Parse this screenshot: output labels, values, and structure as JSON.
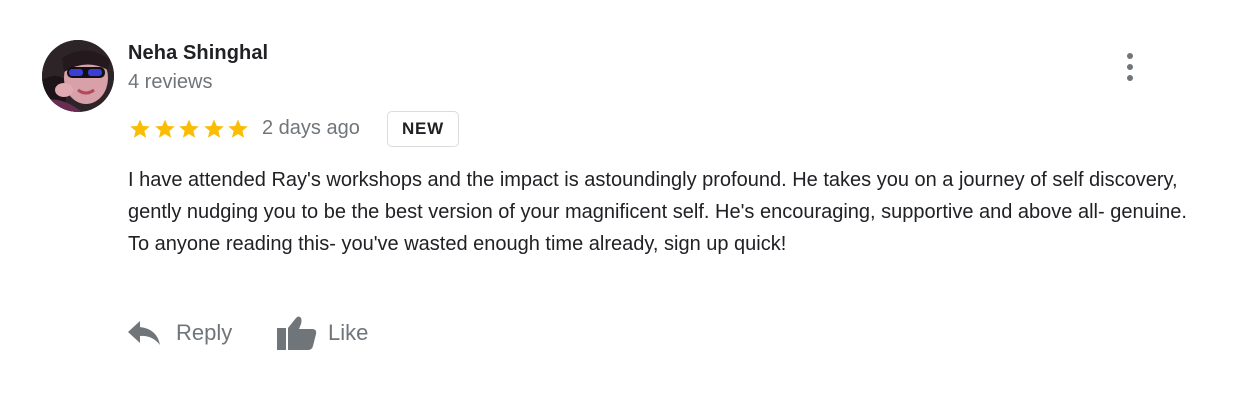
{
  "review": {
    "author_name": "Neha Shinghal",
    "review_count": "4 reviews",
    "rating": 5,
    "rating_max": 5,
    "time": "2 days ago",
    "badge": "NEW",
    "text": "I have attended Ray's workshops and the impact is astoundingly profound. He takes you on a journey of self discovery, gently nudging you to be the best version of your magnificent self. He's encouraging, supportive and above all- genuine. To anyone reading this- you've wasted enough time already, sign up quick!"
  },
  "actions": {
    "reply_label": "Reply",
    "like_label": "Like"
  },
  "icons": {
    "more": "more-vert-icon",
    "star": "star-icon",
    "reply": "reply-icon",
    "like": "thumbs-up-icon"
  },
  "colors": {
    "star": "#fbbc04",
    "primary_text": "#202124",
    "secondary_text": "#70757a",
    "badge_border": "#dadce0"
  }
}
